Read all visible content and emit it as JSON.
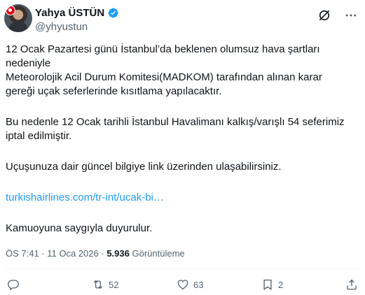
{
  "author": {
    "display_name": "Yahya ÜSTÜN",
    "handle": "@yhyustun",
    "verified": true
  },
  "icons": {
    "verified": "verified-badge-icon",
    "grok": "grok-icon",
    "more": "more-icon",
    "reply": "reply-icon",
    "retweet": "retweet-icon",
    "like": "heart-icon",
    "bookmark": "bookmark-icon",
    "share": "share-icon"
  },
  "tweet": {
    "para1": "12 Ocak Pazartesi günü İstanbul’da beklenen olumsuz hava şartları\nnedeniyle\nMeteorolojik Acil Durum Komitesi(MADKOM) tarafından alınan karar\ngereği uçak seferlerinde kısıtlama yapılacaktır.",
    "para2": "Bu nedenle 12 Ocak tarihli İstanbul Havalimanı kalkış/varışlı 54 seferimiz\niptal edilmiştir.",
    "para3": "Uçuşunuza dair güncel bilgiye link üzerinden ulaşabilirsiniz.",
    "link": "turkishairlines.com/tr-int/ucak-bi…",
    "para4": "Kamuoyuna saygıyla duyurulur."
  },
  "meta": {
    "time": "ÖS 7:41",
    "separator": " · ",
    "date": "11 Oca 2026",
    "views_count": "5.936",
    "views_label": "Görüntüleme"
  },
  "actions": {
    "retweets": "52",
    "likes": "63",
    "bookmarks": "2"
  },
  "colors": {
    "accent": "#1d9bf0",
    "text": "#0f1419",
    "secondary": "#536471"
  }
}
